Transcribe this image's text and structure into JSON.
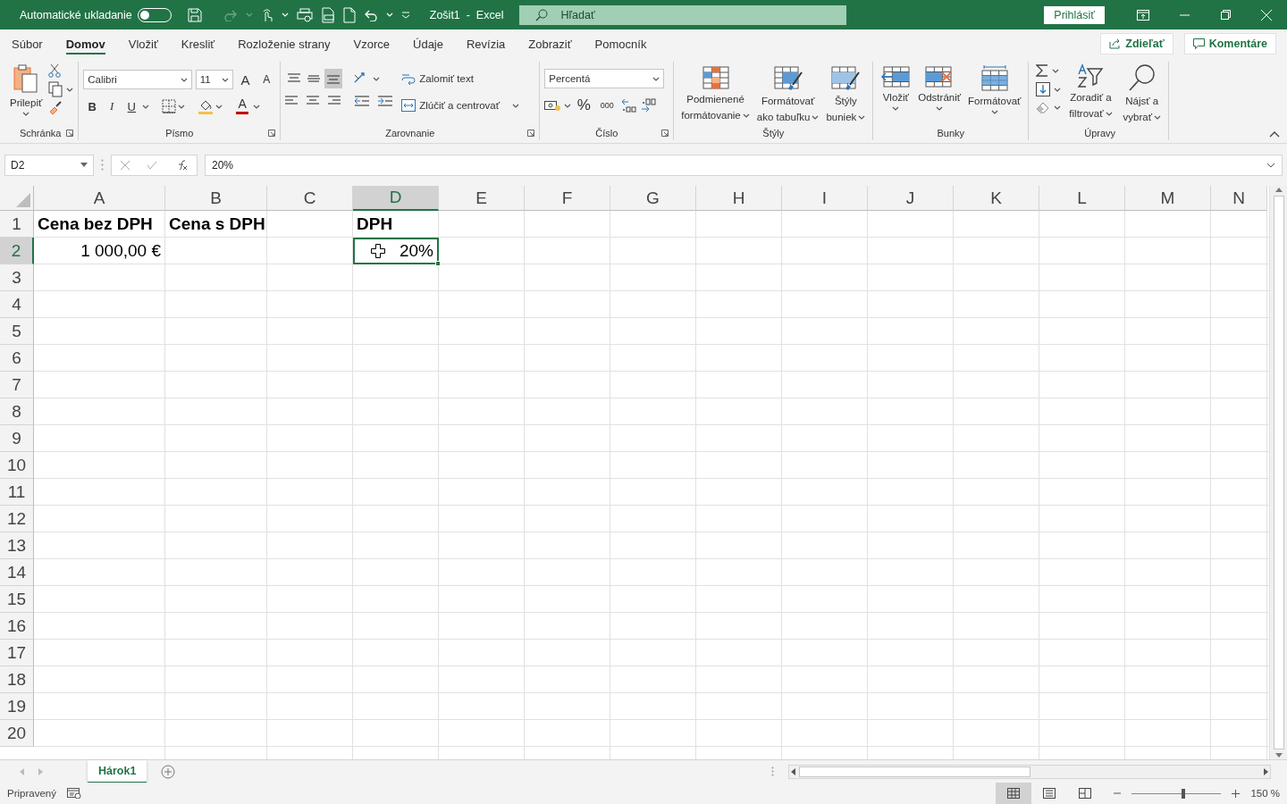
{
  "title_bar": {
    "autosave_label": "Automatické ukladanie",
    "autosave_on": false,
    "document_title": "Zošit1  -  Excel",
    "search_placeholder": "Hľadať",
    "sign_in": "Prihlásiť"
  },
  "menu_tabs": [
    {
      "label": "Súbor",
      "selected": false
    },
    {
      "label": "Domov",
      "selected": true
    },
    {
      "label": "Vložiť",
      "selected": false
    },
    {
      "label": "Kresliť",
      "selected": false
    },
    {
      "label": "Rozloženie strany",
      "selected": false
    },
    {
      "label": "Vzorce",
      "selected": false
    },
    {
      "label": "Údaje",
      "selected": false
    },
    {
      "label": "Revízia",
      "selected": false
    },
    {
      "label": "Zobraziť",
      "selected": false
    },
    {
      "label": "Pomocník",
      "selected": false
    }
  ],
  "share": "Zdieľať",
  "comments": "Komentáre",
  "ribbon": {
    "clipboard": {
      "paste": "Prilepiť",
      "label": "Schránka",
      "launcher": true
    },
    "font": {
      "font_name": "Calibri",
      "font_size": "11",
      "grow": "A",
      "shrink": "A",
      "bold": "B",
      "italic": "I",
      "underline": "U",
      "font_color": "A",
      "label": "Písmo",
      "launcher": true
    },
    "alignment": {
      "vertical_align": [
        {
          "selected": false
        },
        {
          "selected": false
        },
        {
          "selected": true
        }
      ],
      "wrap_text": "Zalomiť text",
      "merge": "Zlúčiť a centrovať",
      "label": "Zarovnanie",
      "launcher": true
    },
    "number": {
      "format": "Percentá",
      "percent": "%",
      "thousands": "000",
      "label": "Číslo",
      "launcher": true
    },
    "styles": {
      "label": "Štýly",
      "launcher": false,
      "buttons": [
        {
          "kind": "conditional",
          "lines": [
            "Podmienené",
            "formátovanie"
          ]
        },
        {
          "kind": "table",
          "lines": [
            "Formátovať",
            "ako tabuľku"
          ]
        },
        {
          "kind": "cell_styles",
          "lines": [
            "Štýly",
            "buniek"
          ]
        }
      ]
    },
    "cells": {
      "label": "Bunky",
      "launcher": false,
      "buttons": [
        {
          "kind": "insert",
          "lines": [
            "Vložiť"
          ]
        },
        {
          "kind": "delete",
          "lines": [
            "Odstrániť"
          ]
        },
        {
          "kind": "format",
          "lines": [
            "Formátovať"
          ]
        }
      ]
    },
    "editing": {
      "label": "Úpravy",
      "launcher": false,
      "buttons": [
        {
          "kind": "sort",
          "lines": [
            "Zoradiť a",
            "filtrovať"
          ]
        },
        {
          "kind": "find",
          "lines": [
            "Nájsť a",
            "vybrať"
          ]
        }
      ]
    }
  },
  "formula_bar": {
    "name_box": "D2",
    "formula": "20%"
  },
  "sheet": {
    "columns": [
      {
        "label": "A",
        "selected": false
      },
      {
        "label": "B",
        "selected": false
      },
      {
        "label": "C",
        "selected": false
      },
      {
        "label": "D",
        "selected": true
      },
      {
        "label": "E",
        "selected": false
      },
      {
        "label": "F",
        "selected": false
      },
      {
        "label": "G",
        "selected": false
      },
      {
        "label": "H",
        "selected": false
      },
      {
        "label": "I",
        "selected": false
      },
      {
        "label": "J",
        "selected": false
      },
      {
        "label": "K",
        "selected": false
      },
      {
        "label": "L",
        "selected": false
      },
      {
        "label": "M",
        "selected": false
      },
      {
        "label": "N",
        "selected": false
      }
    ],
    "rows": [
      {
        "header": "1",
        "selected": false,
        "cells": [
          {
            "text": "Cena bez DPH",
            "bold": true,
            "kind": "text",
            "selected": false
          },
          {
            "text": "Cena s DPH",
            "bold": true,
            "kind": "text",
            "selected": false
          },
          null,
          {
            "text": "DPH",
            "bold": true,
            "kind": "text",
            "selected": false
          }
        ]
      },
      {
        "header": "2",
        "selected": true,
        "cells": [
          {
            "text": "1 000,00 €",
            "bold": false,
            "kind": "number",
            "selected": false
          },
          null,
          null,
          {
            "text": "20%",
            "bold": false,
            "kind": "number",
            "selected": true
          }
        ]
      },
      {
        "header": "3",
        "selected": false,
        "cells": []
      },
      {
        "header": "4",
        "selected": false,
        "cells": []
      },
      {
        "header": "5",
        "selected": false,
        "cells": []
      },
      {
        "header": "6",
        "selected": false,
        "cells": []
      },
      {
        "header": "7",
        "selected": false,
        "cells": []
      },
      {
        "header": "8",
        "selected": false,
        "cells": []
      },
      {
        "header": "9",
        "selected": false,
        "cells": []
      },
      {
        "header": "10",
        "selected": false,
        "cells": []
      },
      {
        "header": "11",
        "selected": false,
        "cells": []
      },
      {
        "header": "12",
        "selected": false,
        "cells": []
      },
      {
        "header": "13",
        "selected": false,
        "cells": []
      },
      {
        "header": "14",
        "selected": false,
        "cells": []
      },
      {
        "header": "15",
        "selected": false,
        "cells": []
      },
      {
        "header": "16",
        "selected": false,
        "cells": []
      },
      {
        "header": "17",
        "selected": false,
        "cells": []
      },
      {
        "header": "18",
        "selected": false,
        "cells": []
      },
      {
        "header": "19",
        "selected": false,
        "cells": []
      },
      {
        "header": "20",
        "selected": false,
        "cells": []
      }
    ]
  },
  "sheet_tabs": [
    {
      "label": "Hárok1",
      "selected": true
    }
  ],
  "status_bar": {
    "status": "Pripravený",
    "views": [
      {
        "kind": "normal",
        "selected": true
      },
      {
        "kind": "page_layout",
        "selected": false
      },
      {
        "kind": "page_break",
        "selected": false
      }
    ],
    "zoom": {
      "level": 0.58
    },
    "zoom_label": "150 %"
  }
}
